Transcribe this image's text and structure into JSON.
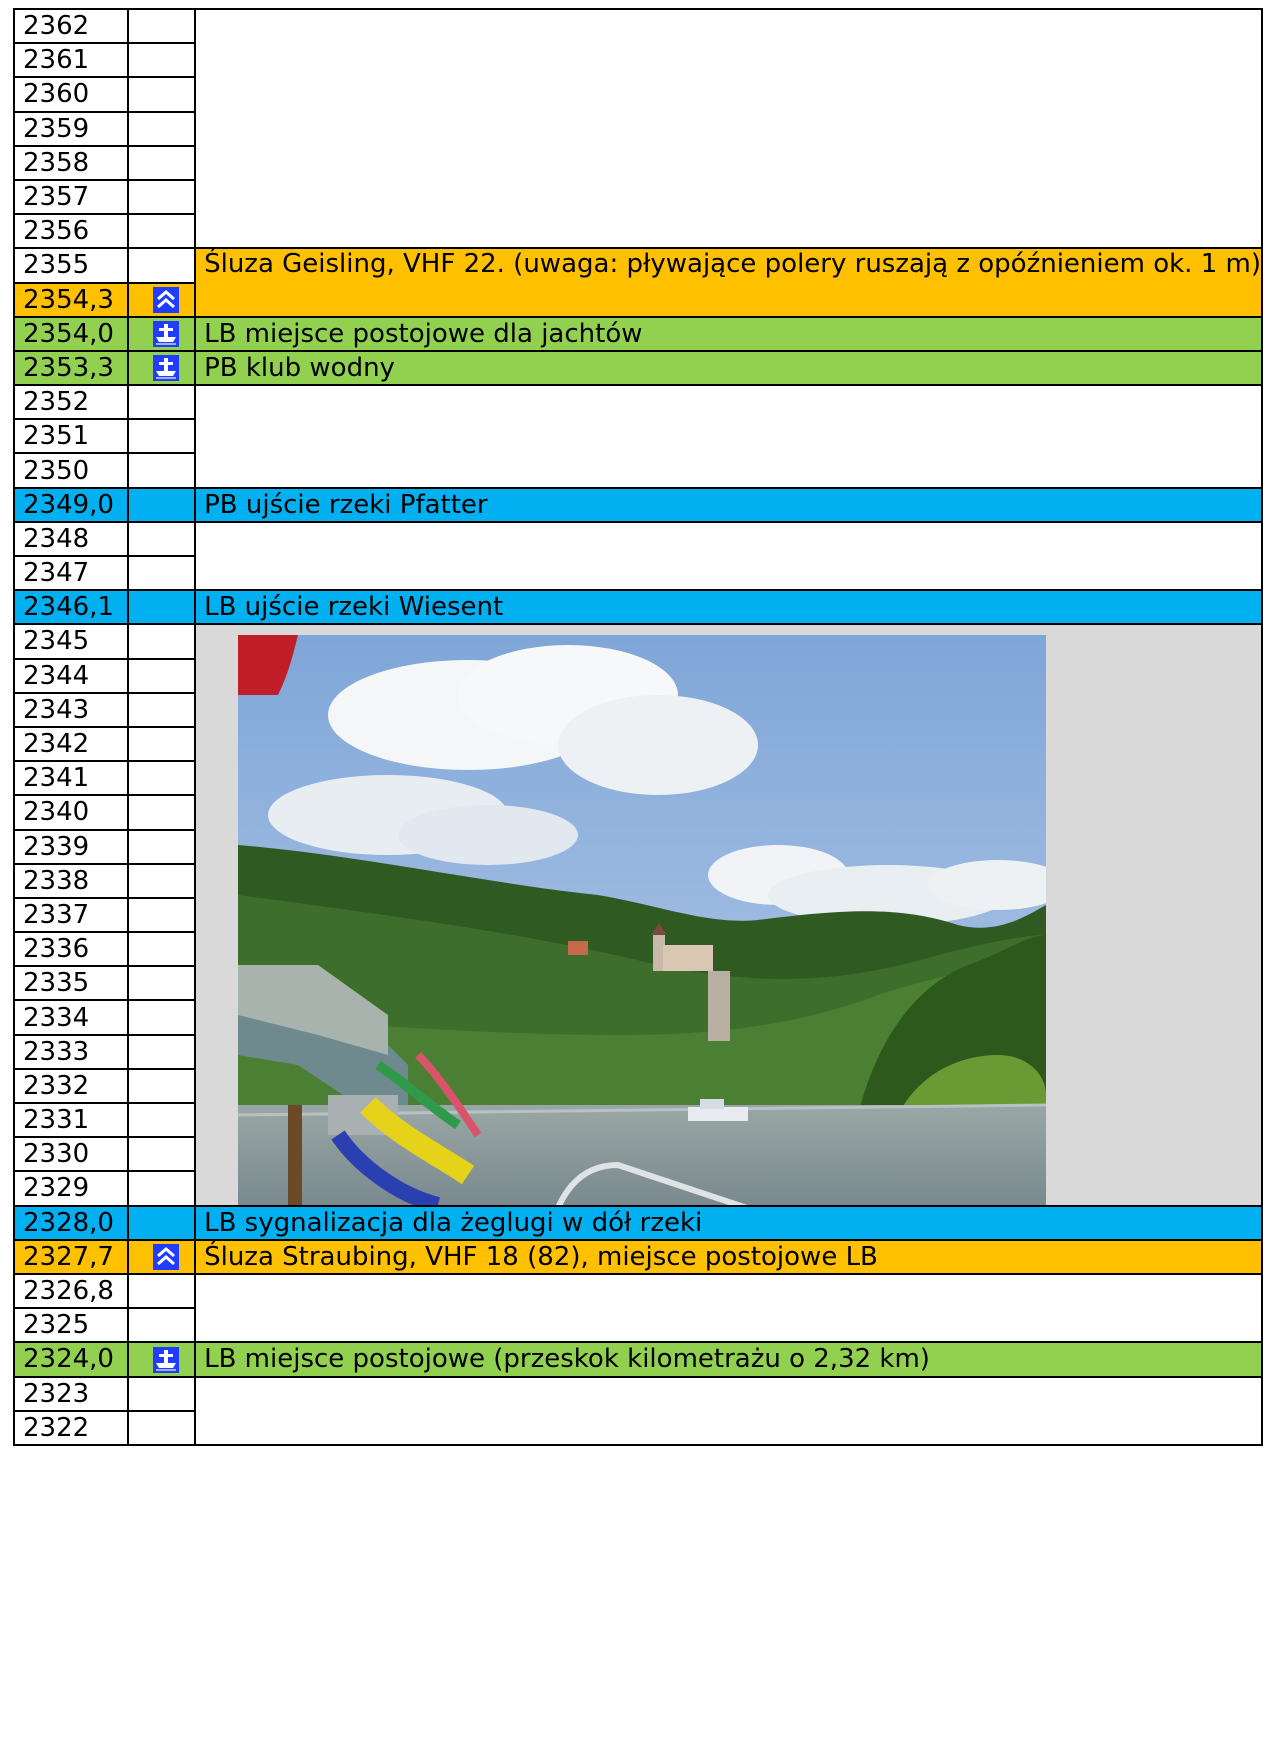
{
  "rows": [
    {
      "km": "2362",
      "type": "plain"
    },
    {
      "km": "2361",
      "type": "plain"
    },
    {
      "km": "2360",
      "type": "plain"
    },
    {
      "km": "2359",
      "type": "plain"
    },
    {
      "km": "2358",
      "type": "plain"
    },
    {
      "km": "2357",
      "type": "plain"
    },
    {
      "km": "2356",
      "type": "plain"
    },
    {
      "km": "2355",
      "type": "plain"
    },
    {
      "km": "2354,3",
      "type": "orange",
      "icon": "lock-icon"
    },
    {
      "km": "2354,0",
      "type": "green",
      "icon": "mooring-icon",
      "note": "LB miejsce postojowe dla jachtów"
    },
    {
      "km": "2353,3",
      "type": "green",
      "icon": "mooring-icon",
      "note": "PB klub wodny"
    },
    {
      "km": "2352",
      "type": "plain"
    },
    {
      "km": "2351",
      "type": "plain"
    },
    {
      "km": "2350",
      "type": "plain"
    },
    {
      "km": "2349,0",
      "type": "blue",
      "note": "PB ujście rzeki Pfatter"
    },
    {
      "km": "2348",
      "type": "plain"
    },
    {
      "km": "2347",
      "type": "plain"
    },
    {
      "km": "2346,1",
      "type": "blue",
      "note": "LB ujście rzeki Wiesent"
    },
    {
      "km": "2345",
      "type": "photo"
    },
    {
      "km": "2344",
      "type": "photo"
    },
    {
      "km": "2343",
      "type": "photo"
    },
    {
      "km": "2342",
      "type": "photo"
    },
    {
      "km": "2341",
      "type": "photo"
    },
    {
      "km": "2340",
      "type": "photo"
    },
    {
      "km": "2339",
      "type": "photo"
    },
    {
      "km": "2338",
      "type": "photo"
    },
    {
      "km": "2337",
      "type": "photo"
    },
    {
      "km": "2336",
      "type": "photo"
    },
    {
      "km": "2335",
      "type": "photo"
    },
    {
      "km": "2334",
      "type": "photo"
    },
    {
      "km": "2333",
      "type": "photo"
    },
    {
      "km": "2332",
      "type": "photo"
    },
    {
      "km": "2331",
      "type": "photo"
    },
    {
      "km": "2330",
      "type": "photo"
    },
    {
      "km": "2329",
      "type": "photo"
    },
    {
      "km": "2328,0",
      "type": "blue",
      "note": "LB sygnalizacja dla żeglugi w dół rzeki"
    },
    {
      "km": "2327,7",
      "type": "orange",
      "icon": "lock-icon",
      "note": "Śluza Straubing, VHF 18 (82), miejsce postojowe LB"
    },
    {
      "km": "2326,8",
      "type": "plain"
    },
    {
      "km": "2325",
      "type": "plain"
    },
    {
      "km": "2324,0",
      "type": "green",
      "icon": "mooring-icon",
      "note": "LB miejsce postojowe (przeskok kilometrażu o 2,32 km)"
    },
    {
      "km": "2323",
      "type": "plain"
    },
    {
      "km": "2322",
      "type": "plain"
    }
  ],
  "geisling_note": "Śluza Geisling, VHF 22. (uwaga: pływające polery ruszają z opóźnieniem ok. 1 m)",
  "colors": {
    "orange": "#ffc000",
    "green": "#92d050",
    "blue": "#00b0f0",
    "icon_bg": "#1f3cff"
  }
}
